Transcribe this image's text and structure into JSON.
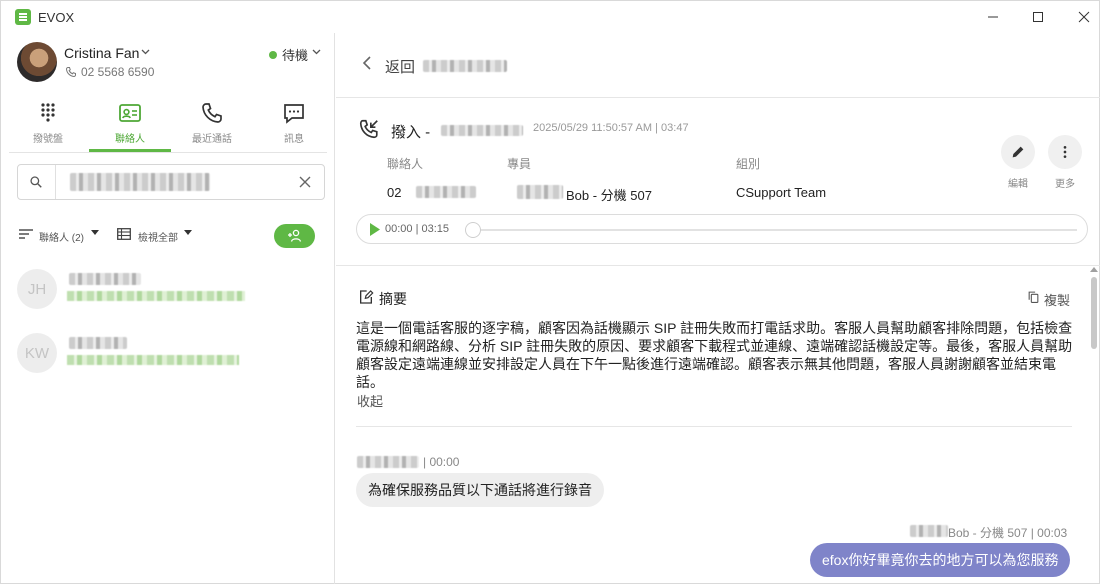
{
  "window": {
    "app_title": "EVOX",
    "brand_color": "#5fb845"
  },
  "user": {
    "name": "Cristina Fan",
    "phone": "02 5568 6590",
    "status": "待機"
  },
  "nav": {
    "items": [
      {
        "label": "撥號盤",
        "icon": "dialpad-icon",
        "active": false
      },
      {
        "label": "聯絡人",
        "icon": "contact-card-icon",
        "active": true
      },
      {
        "label": "最近通話",
        "icon": "phone-icon",
        "active": false
      },
      {
        "label": "訊息",
        "icon": "message-icon",
        "active": false
      }
    ]
  },
  "search": {
    "value": "redacted"
  },
  "filters": {
    "contacts_label": "聯絡人 (2)",
    "view_label": "檢視全部"
  },
  "contacts": [
    {
      "initials": "JH"
    },
    {
      "initials": "KW"
    }
  ],
  "call": {
    "back_label": "返回",
    "type": "撥入 -",
    "meta": "2025/05/29 11:50:57 AM | 03:47",
    "labels": {
      "contact": "聯絡人",
      "agent": "專員",
      "group": "組別"
    },
    "contact_prefix": "02",
    "agent": "Bob - 分機 507",
    "group": "CSupport Team",
    "edit_label": "編輯",
    "more_label": "更多",
    "player_time": "00:00 | 03:15",
    "progress": 0
  },
  "summary": {
    "title": "摘要",
    "copy_label": "複製",
    "text": "這是一個電話客服的逐字稿，顧客因為話機顯示 SIP 註冊失敗而打電話求助。客服人員幫助顧客排除問題，包括檢查電源線和網路線、分析 SIP 註冊失敗的原因、要求顧客下載程式並連線、遠端確認話機設定等。最後，客服人員幫助顧客設定遠端連線並安排設定人員在下午一點後進行遠端確認。顧客表示無其他問題，客服人員謝謝顧客並結束電話。",
    "collapse_label": "收起"
  },
  "transcript": [
    {
      "side": "left",
      "meta": "| 00:00",
      "text": "為確保服務品質以下通話將進行錄音"
    },
    {
      "side": "right",
      "meta": "Bob - 分機 507 | 00:03",
      "text": "efox你好畢竟你去的地方可以為您服務"
    }
  ]
}
